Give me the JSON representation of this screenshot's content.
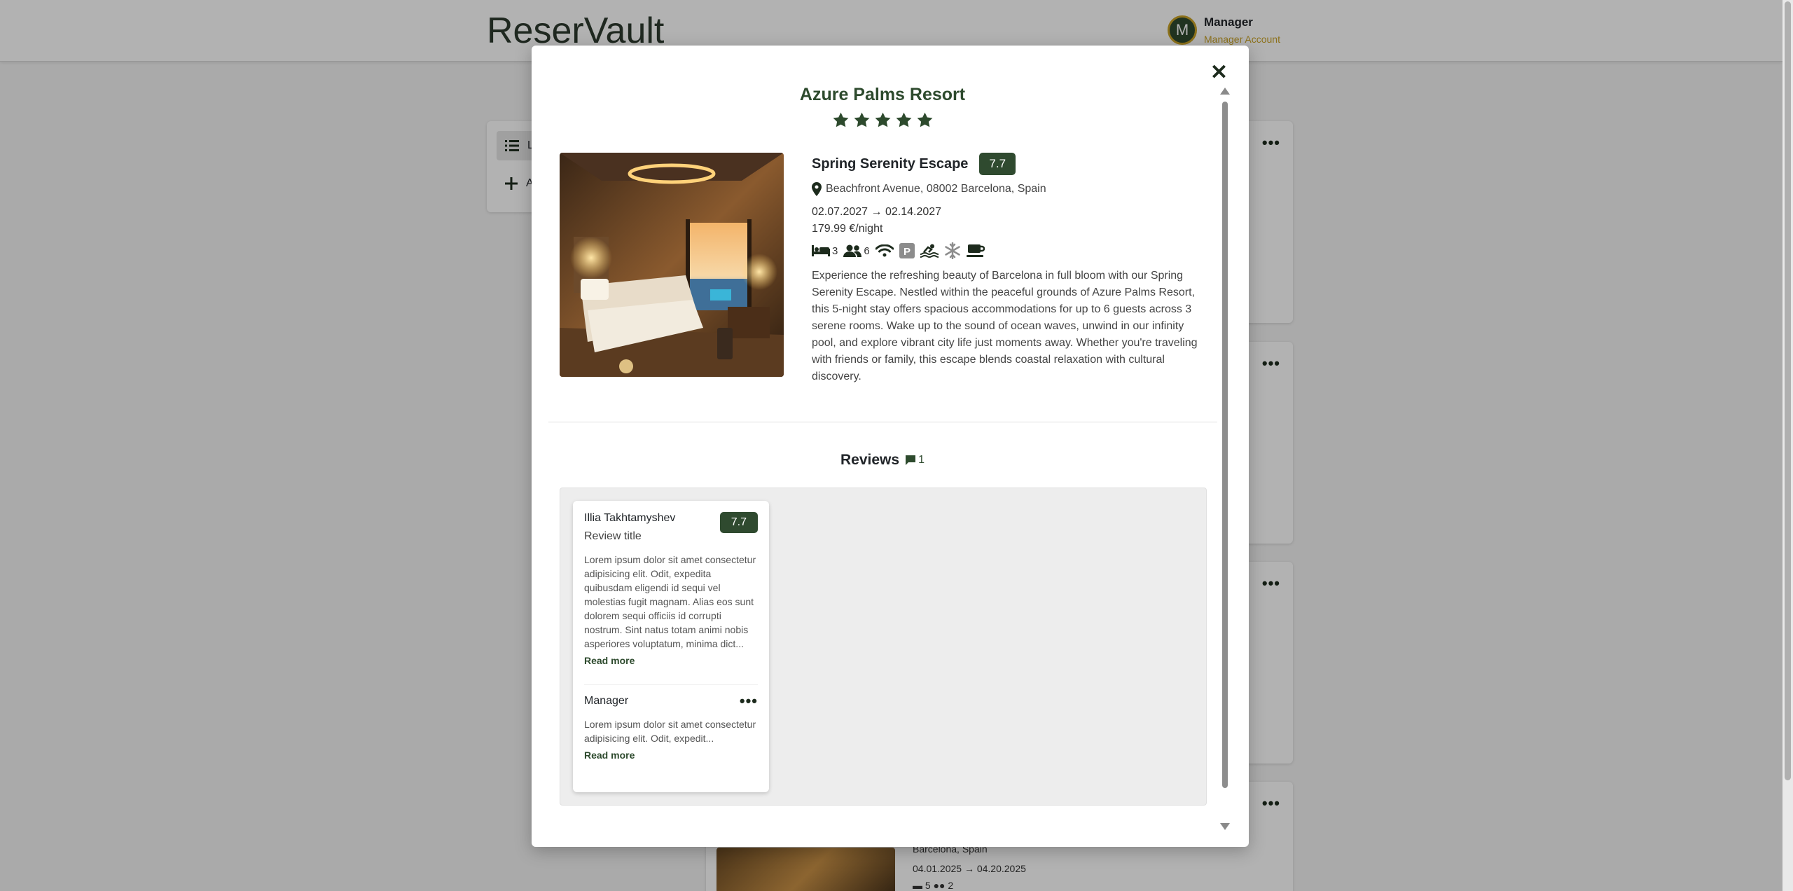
{
  "app": {
    "brand": "ReserVault"
  },
  "account": {
    "initial": "M",
    "name": "Manager",
    "role": "Manager Account"
  },
  "sidebar": {
    "items": [
      {
        "label": "L",
        "icon": "list-icon"
      },
      {
        "label": "A",
        "icon": "plus-icon"
      }
    ]
  },
  "background_listing": {
    "location": "Barcelona, Spain",
    "dates": "04.01.2025 → 04.20.2025",
    "beds": "5",
    "guests": "2"
  },
  "modal": {
    "hotel_name": "Azure Palms Resort",
    "stars": 5,
    "room": {
      "name": "Spring Serenity Escape",
      "score": "7.7",
      "address": "Beachfront Avenue, 08002 Barcelona, Spain",
      "dates": "02.07.2027 → 02.14.2027",
      "price": "179.99 €/night",
      "beds": "3",
      "guests": "6",
      "amenities": [
        "wifi-icon",
        "parking-icon",
        "pool-icon",
        "air-conditioning-icon",
        "breakfast-icon"
      ],
      "description": "Experience the refreshing beauty of Barcelona in full bloom with our Spring Serenity Escape. Nestled within the peaceful grounds of Azure Palms Resort, this 5-night stay offers spacious accommodations for up to 6 guests across 3 serene rooms. Wake up to the sound of ocean waves, unwind in our infinity pool, and explore vibrant city life just moments away. Whether you're traveling with friends or family, this escape blends coastal relaxation with cultural discovery."
    },
    "reviews": {
      "title": "Reviews",
      "count": "1",
      "items": [
        {
          "author": "Illia Takhtamyshev",
          "title": "Review title",
          "score": "7.7",
          "body": "Lorem ipsum dolor sit amet consectetur adipisicing elit. Odit, expedita quibusdam eligendi id sequi vel molestias fugit magnam. Alias eos sunt dolorem sequi officiis id corrupti nostrum. Sint natus totam animi nobis asperiores voluptatum, minima dict...",
          "read_more": "Read more",
          "reply": {
            "author": "Manager",
            "body": "Lorem ipsum dolor sit amet consectetur adipisicing elit. Odit, expedit...",
            "read_more": "Read more"
          }
        }
      ]
    }
  },
  "colors": {
    "brand_green": "#2f4a2f",
    "accent_gold": "#c9a227"
  }
}
